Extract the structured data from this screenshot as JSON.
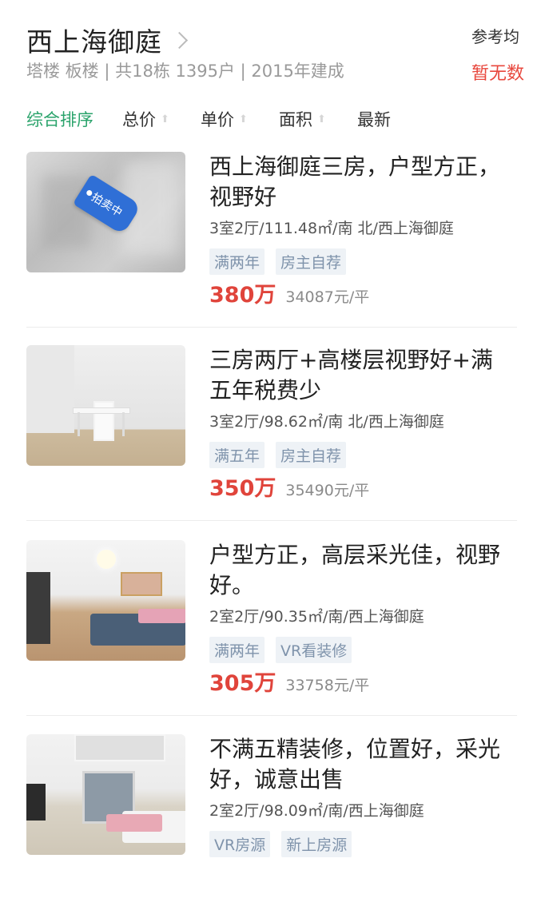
{
  "header": {
    "title": "西上海御庭",
    "subtitle": "塔楼 板楼 | 共18栋 1395户 | 2015年建成",
    "ref_label": "参考均",
    "ref_value": "暂无数"
  },
  "sort": {
    "items": [
      {
        "label": "综合排序",
        "active": true,
        "arrow": false
      },
      {
        "label": "总价",
        "active": false,
        "arrow": true
      },
      {
        "label": "单价",
        "active": false,
        "arrow": true
      },
      {
        "label": "面积",
        "active": false,
        "arrow": true
      },
      {
        "label": "最新",
        "active": false,
        "arrow": false
      }
    ]
  },
  "listings": [
    {
      "title": "西上海御庭三房，户型方正，视野好",
      "meta": "3室2厅/111.48㎡/南 北/西上海御庭",
      "tags": [
        "满两年",
        "房主自荐"
      ],
      "price": "380万",
      "unit_price": "34087元/平",
      "badge": "拍卖中"
    },
    {
      "title": "三房两厅+高楼层视野好+满五年税费少",
      "meta": "3室2厅/98.62㎡/南 北/西上海御庭",
      "tags": [
        "满五年",
        "房主自荐"
      ],
      "price": "350万",
      "unit_price": "35490元/平"
    },
    {
      "title": "户型方正，高层采光佳，视野好。",
      "meta": "2室2厅/90.35㎡/南/西上海御庭",
      "tags": [
        "满两年",
        "VR看装修"
      ],
      "price": "305万",
      "unit_price": "33758元/平"
    },
    {
      "title": "不满五精装修，位置好，采光好，诚意出售",
      "meta": "2室2厅/98.09㎡/南/西上海御庭",
      "tags": [
        "VR房源",
        "新上房源"
      ],
      "price": "",
      "unit_price": ""
    }
  ],
  "icons": {
    "chevron": "chevron-right-icon",
    "sort_arrow": "sort-arrow-icon"
  },
  "colors": {
    "accent_green": "#2aa36b",
    "price_red": "#e0443b",
    "tag_bg": "#eef2f6",
    "tag_text": "#7f93ab"
  }
}
